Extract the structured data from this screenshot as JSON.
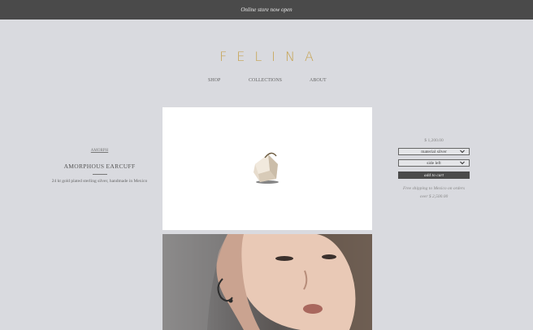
{
  "announcement": "Online store now open",
  "brand": "FELINA",
  "nav": {
    "shop": "SHOP",
    "collections": "COLLECTIONS",
    "about": "ABOUT"
  },
  "product": {
    "breadcrumb": "AMORPH",
    "title": "AMORPHOUS EARCUFF",
    "description": "24 kt gold plated sterling silver, handmade in Mexico",
    "price": "$ 1,200.00",
    "material": "material silver",
    "side": "side left",
    "add_to_cart": "add to cart",
    "shipping_line1": "Free shipping to Mexico on orders",
    "shipping_line2": "over $ 2,500.00"
  },
  "colors": {
    "brand_gold": "#c6a24f",
    "background": "#d9dadf",
    "dark_bar": "#4a4a4a"
  }
}
